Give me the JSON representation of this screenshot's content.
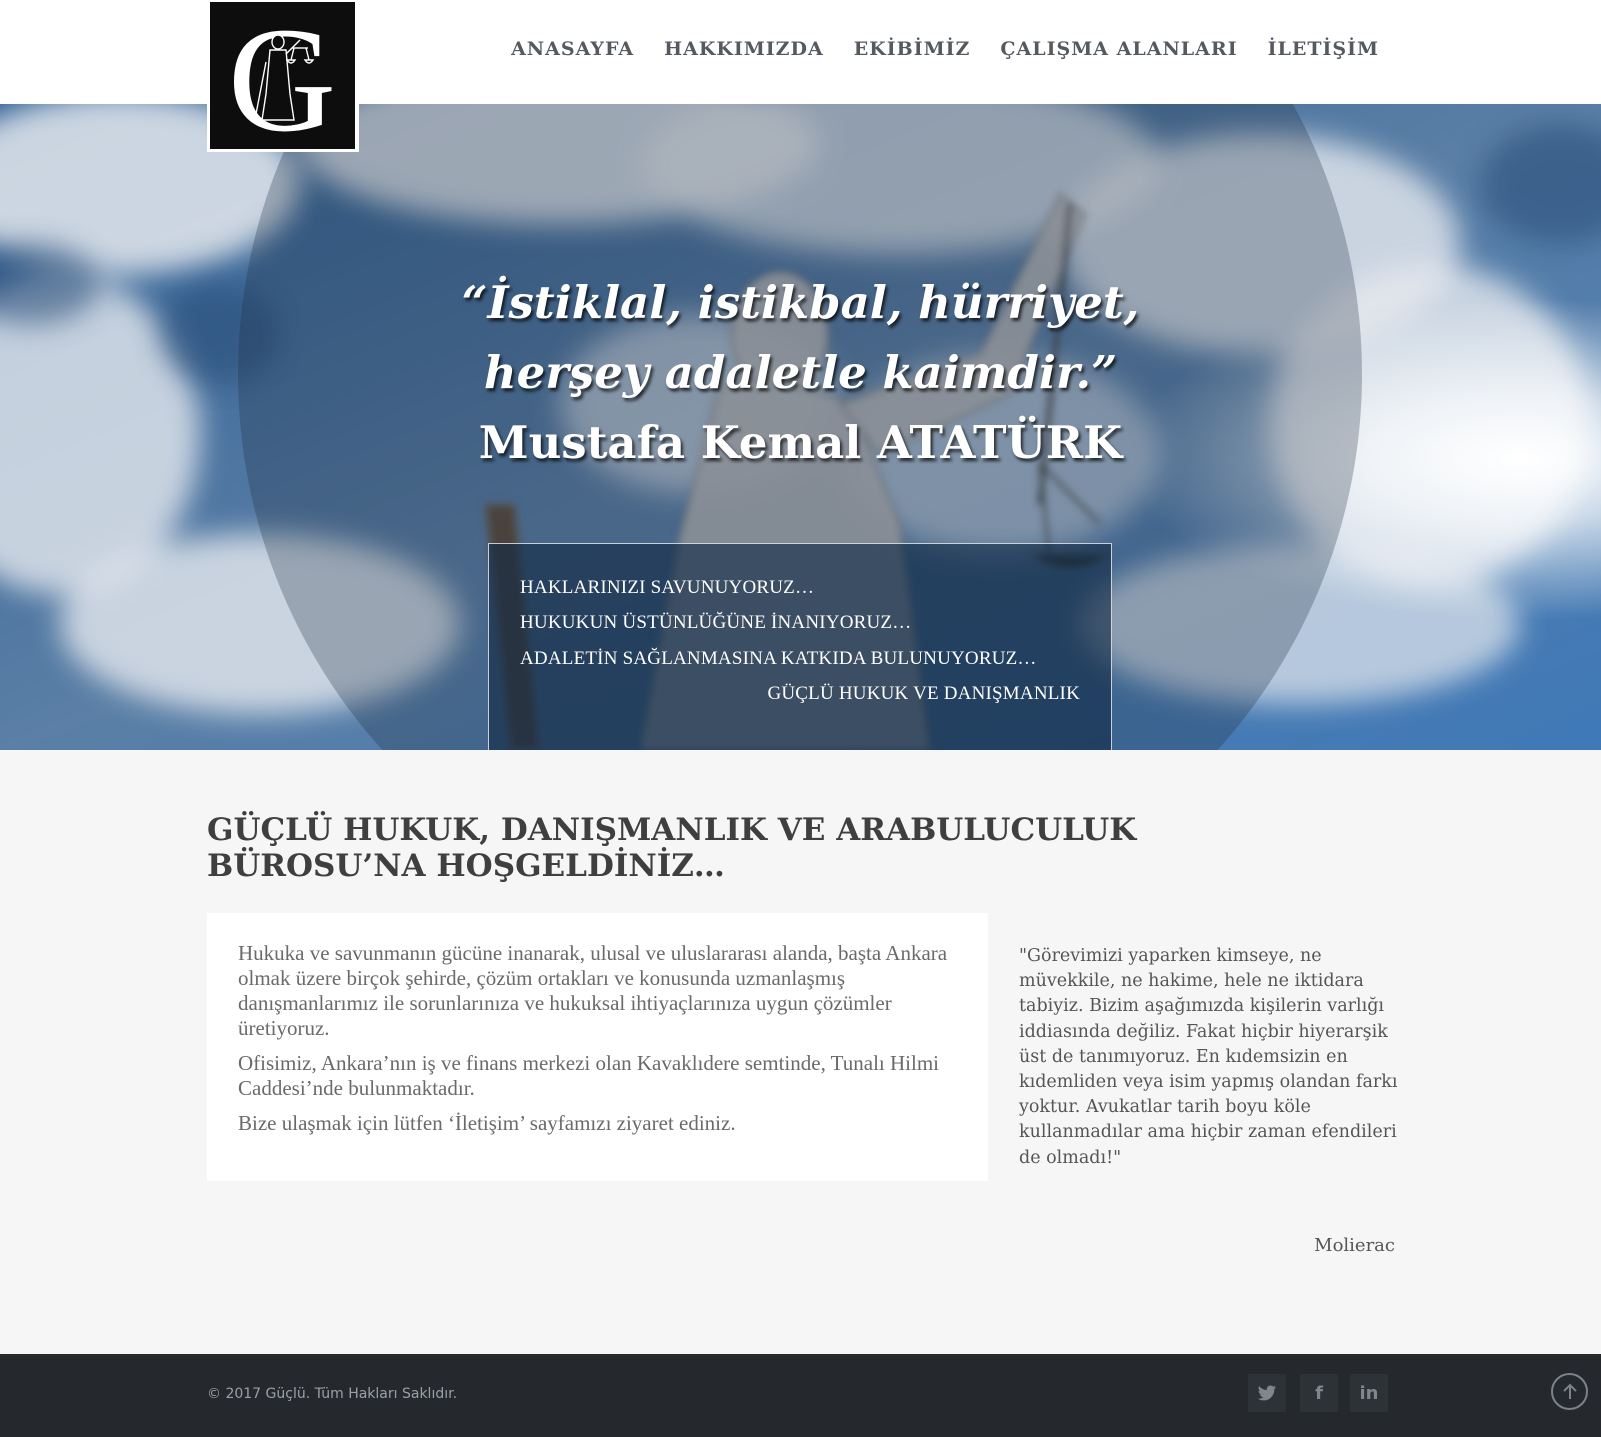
{
  "logo": {
    "letter": "G"
  },
  "nav": {
    "items": [
      {
        "label": "ANASAYFA"
      },
      {
        "label": "HAKKIMIZDA"
      },
      {
        "label": "EKİBİMİZ"
      },
      {
        "label": "ÇALIŞMA ALANLARI"
      },
      {
        "label": "İLETİŞİM"
      }
    ]
  },
  "hero": {
    "quote_line1": "“İstiklal, istikbal, hürriyet,",
    "quote_line2": "herşey adaletle kaimdir.”",
    "author": "Mustafa Kemal ATATÜRK",
    "box_lines": [
      "HAKLARINIZI SAVUNUYORUZ…",
      "HUKUKUN ÜSTÜNLÜĞÜNE İNANIYORUZ…",
      "ADALETİN SAĞLANMASINA KATKIDA BULUNUYORUZ…",
      "GÜÇLÜ HUKUK VE DANIŞMANLIK"
    ]
  },
  "main": {
    "title": "GÜÇLÜ HUKUK, DANIŞMANLIK VE ARABULUCULUK BÜROSU’NA HOŞGELDİNİZ…",
    "paragraphs": [
      "Hukuka ve savunmanın gücüne inanarak, ulusal ve uluslararası alanda, başta Ankara olmak üzere birçok şehirde, çözüm ortakları ve konusunda uzmanlaşmış danışmanlarımız ile sorunlarınıza ve hukuksal ihtiyaçlarınıza uygun çözümler üretiyoruz.",
      "Ofisimiz, Ankara’nın iş ve finans merkezi olan Kavaklıdere semtinde, Tunalı Hilmi Caddesi’nde bulunmaktadır.",
      "Bize ulaşmak için lütfen ‘İletişim’ sayfamızı ziyaret ediniz."
    ],
    "side_quote": "\"Görevimizi yaparken kimseye, ne müvekkile, ne hakime, hele ne iktidara tabiyiz. Bizim aşağımızda kişilerin varlığı iddiasında değiliz. Fakat hiçbir hiyerarşik üst de tanımıyoruz. En kıdemsizin en kıdemliden veya isim yapmış olandan farkı yoktur. Avukatlar tarih boyu köle kullanmadılar ama hiçbir zaman efendileri de olmadı!\"",
    "side_author": "Molierac"
  },
  "footer": {
    "copyright": "© 2017 Güçlü. Tüm Hakları Saklıdır.",
    "social": [
      {
        "icon": "twitter-icon"
      },
      {
        "icon": "facebook-icon",
        "glyph": "f"
      },
      {
        "icon": "linkedin-icon",
        "glyph": "in"
      }
    ]
  },
  "colors": {
    "header_bg": "#ffffff",
    "nav_text": "#555a60",
    "body_bg": "#f6f6f6",
    "title_text": "#3f3f3f",
    "footer_bg": "#25292d",
    "sky_blue": "#2f6aa8"
  }
}
